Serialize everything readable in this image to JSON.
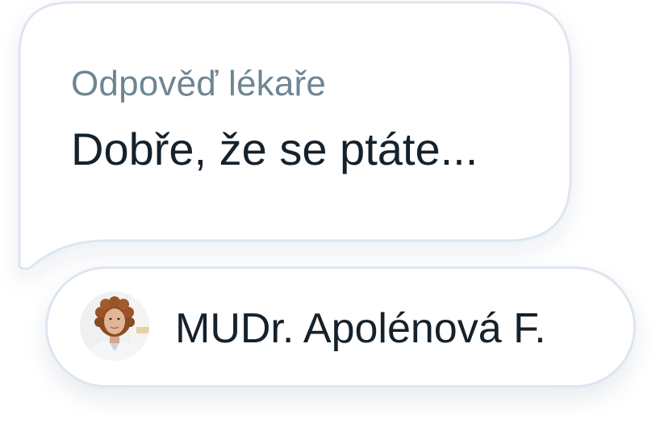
{
  "message_bubble": {
    "label": "Odpověď lékaře",
    "message": "Dobře, že se ptáte..."
  },
  "doctor": {
    "name": "MUDr. Apolénová F.",
    "avatar_icon": "doctor-portrait"
  },
  "colors": {
    "label_text": "#6e8593",
    "message_text": "#15212b",
    "name_text": "#15212b",
    "border": "#dde6f0",
    "background": "#ffffff"
  }
}
